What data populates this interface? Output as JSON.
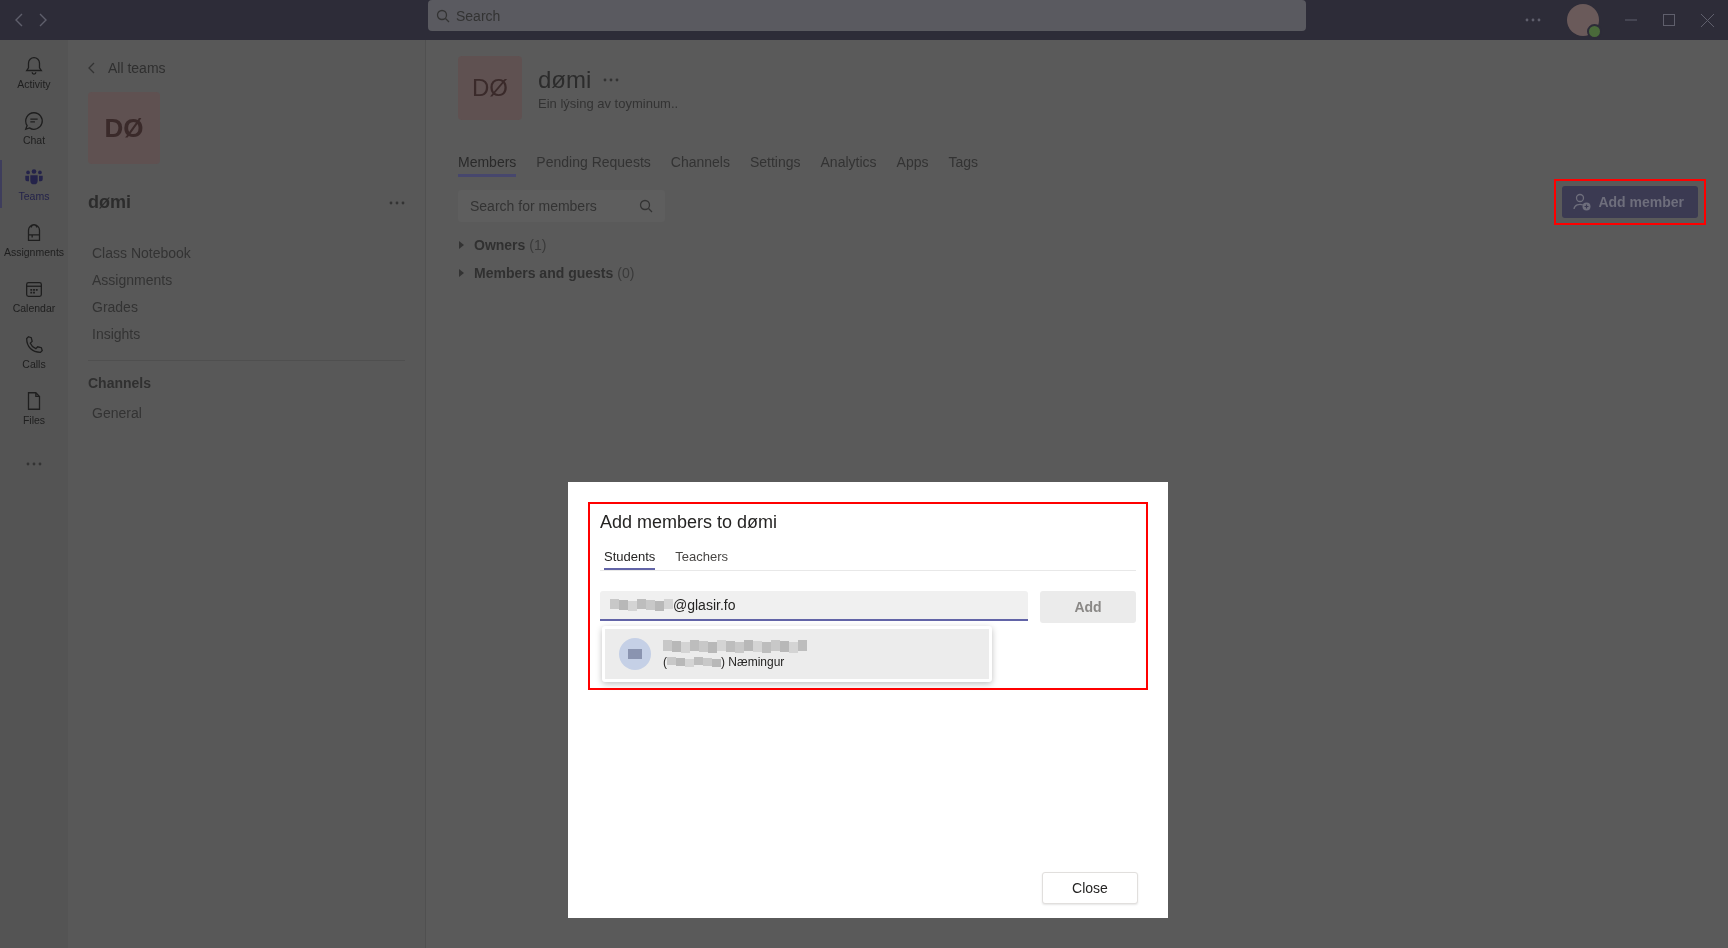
{
  "titlebar": {
    "search_placeholder": "Search"
  },
  "rail": [
    {
      "label": "Activity",
      "kind": "bell",
      "selected": false
    },
    {
      "label": "Chat",
      "kind": "chat",
      "selected": false
    },
    {
      "label": "Teams",
      "kind": "teams",
      "selected": true
    },
    {
      "label": "Assignments",
      "kind": "bag",
      "selected": false
    },
    {
      "label": "Calendar",
      "kind": "calendar",
      "selected": false
    },
    {
      "label": "Calls",
      "kind": "phone",
      "selected": false
    },
    {
      "label": "Files",
      "kind": "file",
      "selected": false
    }
  ],
  "sidebar": {
    "back_link": "All teams",
    "team_initials": "DØ",
    "team_name": "dømi",
    "items": [
      "Class Notebook",
      "Assignments",
      "Grades",
      "Insights"
    ],
    "section_title": "Channels",
    "channels": [
      "General"
    ]
  },
  "team": {
    "initials": "DØ",
    "name": "dømi",
    "description": "Ein lýsing av toyminum..",
    "tabs": [
      {
        "label": "Members",
        "selected": true
      },
      {
        "label": "Pending Requests",
        "selected": false
      },
      {
        "label": "Channels",
        "selected": false
      },
      {
        "label": "Settings",
        "selected": false
      },
      {
        "label": "Analytics",
        "selected": false
      },
      {
        "label": "Apps",
        "selected": false
      },
      {
        "label": "Tags",
        "selected": false
      }
    ],
    "search_placeholder": "Search for members",
    "groups": [
      {
        "label": "Owners",
        "count": "(1)",
        "expanded": false
      },
      {
        "label": "Members and guests",
        "count": "(0)",
        "expanded": false
      }
    ],
    "add_member": "Add member"
  },
  "dialog": {
    "title": "Add members to dømi",
    "tabs": [
      {
        "label": "Students",
        "selected": true
      },
      {
        "label": "Teachers",
        "selected": false
      }
    ],
    "input_value": "@glasir.fo",
    "add_button": "Add",
    "add_disabled": true,
    "suggestion": {
      "open": "(",
      "detail": ") Næmingur"
    },
    "close_button": "Close"
  }
}
